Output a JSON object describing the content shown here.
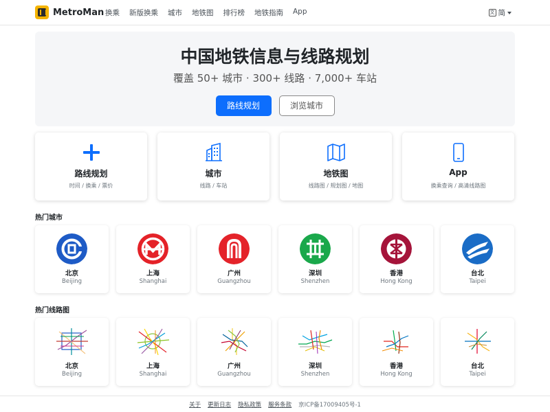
{
  "brand": {
    "name": "MetroMan"
  },
  "nav": [
    "换乘",
    "新版换乘",
    "城市",
    "地铁图",
    "排行榜",
    "地铁指南",
    "App"
  ],
  "lang": {
    "label": "简"
  },
  "hero": {
    "title": "中国地铁信息与线路规划",
    "subtitle": "覆盖 50+ 城市 · 300+ 线路 · 7,000+ 车站",
    "primary_button": "路线规划",
    "secondary_button": "浏览城市"
  },
  "features": [
    {
      "title": "路线规划",
      "sub": "时间 / 换乘 / 票价",
      "icon": "plus-icon"
    },
    {
      "title": "城市",
      "sub": "线路 / 车站",
      "icon": "city-building-icon"
    },
    {
      "title": "地铁图",
      "sub": "线路图 / 规划图 / 地图",
      "icon": "map-icon"
    },
    {
      "title": "App",
      "sub": "换乘查询 / 高清线路图",
      "icon": "phone-icon"
    }
  ],
  "hot_cities": {
    "title": "热门城市",
    "items": [
      {
        "name": "北京",
        "en": "Beijing",
        "color": "#1e5bc6"
      },
      {
        "name": "上海",
        "en": "Shanghai",
        "color": "#e42228"
      },
      {
        "name": "广州",
        "en": "Guangzhou",
        "color": "#e4232a"
      },
      {
        "name": "深圳",
        "en": "Shenzhen",
        "color": "#1aa84b"
      },
      {
        "name": "香港",
        "en": "Hong Kong",
        "color": "#a5143a"
      },
      {
        "name": "台北",
        "en": "Taipei",
        "color": "#1a6cc6"
      }
    ]
  },
  "hot_maps": {
    "title": "热门线路图",
    "items": [
      {
        "name": "北京",
        "en": "Beijing"
      },
      {
        "name": "上海",
        "en": "Shanghai"
      },
      {
        "name": "广州",
        "en": "Guangzhou"
      },
      {
        "name": "深圳",
        "en": "Shenzhen"
      },
      {
        "name": "香港",
        "en": "Hong Kong"
      },
      {
        "name": "台北",
        "en": "Taipei"
      }
    ]
  },
  "footer": {
    "links": [
      "关于",
      "更新日志",
      "隐私政策",
      "服务条款"
    ],
    "icp": "京ICP备17009405号-1"
  }
}
